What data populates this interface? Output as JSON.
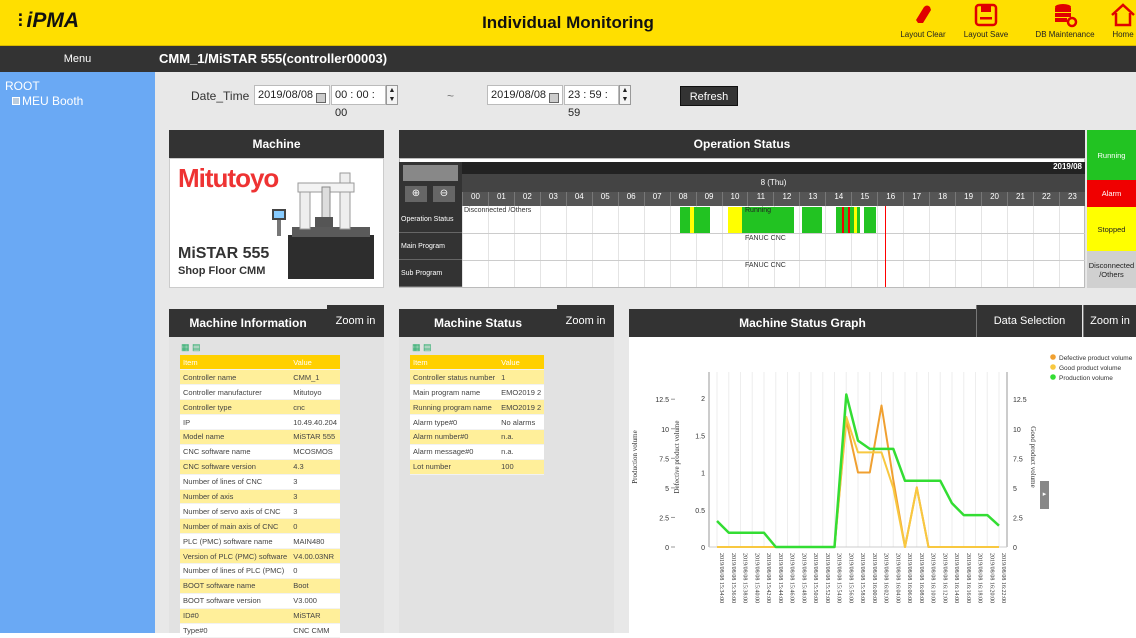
{
  "app": {
    "logo": "iPMA",
    "title": "Individual Monitoring",
    "toolbar": [
      {
        "label": "Layout Clear",
        "icon": "eraser-icon",
        "color": "#e00000"
      },
      {
        "label": "Layout Save",
        "icon": "save-icon",
        "color": "#e00000"
      },
      {
        "label": "DB Maintenance",
        "icon": "database-gear-icon",
        "color": "#e00000"
      },
      {
        "label": "Home",
        "icon": "home-icon",
        "color": "#e00000"
      }
    ]
  },
  "menu": {
    "label": "Menu"
  },
  "breadcrumb": "CMM_1/MiSTAR 555(controller00003)",
  "tree": {
    "root": "ROOT",
    "child": "MEU Booth"
  },
  "datetime": {
    "label": "Date_Time",
    "from_date": "2019/08/08",
    "from_time": "00 : 00 : 00",
    "separator": "~",
    "to_date": "2019/08/08",
    "to_time": "23 : 59 : 59",
    "refresh": "Refresh"
  },
  "machine_panel": {
    "title": "Machine",
    "brand": "Mitutoyo",
    "model": "MiSTAR 555",
    "subtitle": "Shop Floor CMM"
  },
  "operation": {
    "title": "Operation Status",
    "year": "2019/08",
    "day": "8 (Thu)",
    "hours": [
      "00",
      "01",
      "02",
      "03",
      "04",
      "05",
      "06",
      "07",
      "08",
      "09",
      "10",
      "11",
      "12",
      "13",
      "14",
      "15",
      "16",
      "17",
      "18",
      "19",
      "20",
      "21",
      "22",
      "23"
    ],
    "rows": [
      "Operation Status",
      "Main Program",
      "Sub Program"
    ],
    "row_texts": {
      "disconnected": "Disconnected /Others",
      "running": "Running",
      "main_program": "FANUC CNC",
      "sub_program": "FANUC CNC"
    },
    "legend": [
      {
        "label": "Running",
        "color": "#22c322"
      },
      {
        "label": "Alarm",
        "color": "#f00000"
      },
      {
        "label": "Stopped",
        "color": "#ffff00"
      },
      {
        "label": "Disconnected /Others",
        "color": "#d0d0d0"
      }
    ]
  },
  "machine_info": {
    "title": "Machine Information",
    "zoom": "Zoom in",
    "header": [
      "Item",
      "Value"
    ],
    "rows": [
      [
        "Controller name",
        "CMM_1"
      ],
      [
        "Controller manufacturer",
        "Mitutoyo"
      ],
      [
        "Controller type",
        "cnc"
      ],
      [
        "IP",
        "10.49.40.204"
      ],
      [
        "Model name",
        "MiSTAR 555"
      ],
      [
        "CNC software name",
        "MCOSMOS"
      ],
      [
        "CNC software version",
        "4.3"
      ],
      [
        "Number of lines of CNC",
        "3"
      ],
      [
        "Number of axis",
        "3"
      ],
      [
        "Number of servo axis of CNC",
        "3"
      ],
      [
        "Number of main axis of CNC",
        "0"
      ],
      [
        "PLC (PMC) software name",
        "MAIN480"
      ],
      [
        "Version of PLC (PMC) software",
        "V4.00.03NR"
      ],
      [
        "Number of lines of PLC (PMC)",
        "0"
      ],
      [
        "BOOT software name",
        "Boot"
      ],
      [
        "BOOT software version",
        "V3.000"
      ],
      [
        "ID#0",
        "MiSTAR"
      ],
      [
        "Type#0",
        "CNC CMM"
      ]
    ]
  },
  "machine_status": {
    "title": "Machine Status",
    "zoom": "Zoom in",
    "header": [
      "Item",
      "Value"
    ],
    "rows": [
      [
        "Controller status number",
        "1"
      ],
      [
        "Main program name",
        "EMO2019 2"
      ],
      [
        "Running program name",
        "EMO2019 2"
      ],
      [
        "Alarm type#0",
        "No alarms"
      ],
      [
        "Alarm number#0",
        "n.a."
      ],
      [
        "Alarm message#0",
        "n.a."
      ],
      [
        "Lot number",
        "100"
      ]
    ]
  },
  "graph": {
    "title": "Machine Status Graph",
    "data_selection": "Data Selection",
    "zoom": "Zoom in",
    "chart_data": {
      "type": "line",
      "ylabel_left_outer": "Production volume",
      "ylabel_left_inner": "Defective product volume",
      "ylabel_right": "Good product volume",
      "left_outer_ticks": [
        "12.5",
        "10",
        "7.5",
        "5",
        "2.5",
        "0"
      ],
      "left_inner_ticks": [
        "2",
        "1.5",
        "1",
        "0.5",
        "0"
      ],
      "right_ticks": [
        "12.5",
        "10",
        "7.5",
        "5",
        "2.5",
        "0"
      ],
      "legend": [
        "Defective product volume",
        "Good product volume",
        "Production volume"
      ],
      "x": [
        "2019/08/08 15:34:00",
        "2019/08/08 15:36:00",
        "2019/08/08 15:38:00",
        "2019/08/08 15:40:00",
        "2019/08/08 15:42:00",
        "2019/08/08 15:44:00",
        "2019/08/08 15:46:00",
        "2019/08/08 15:48:00",
        "2019/08/08 15:50:00",
        "2019/08/08 15:52:00",
        "2019/08/08 15:54:00",
        "2019/08/08 15:56:00",
        "2019/08/08 15:58:00",
        "2019/08/08 16:00:00",
        "2019/08/08 16:02:00",
        "2019/08/08 16:04:00",
        "2019/08/08 16:06:00",
        "2019/08/08 16:08:00",
        "2019/08/08 16:10:00",
        "2019/08/08 16:12:00",
        "2019/08/08 16:14:00",
        "2019/08/08 16:16:00",
        "2019/08/08 16:18:00",
        "2019/08/08 16:20:00",
        "2019/08/08 16:22:00"
      ],
      "series": [
        {
          "name": "Defective product volume",
          "color": "#f0a030",
          "axis": "inner",
          "values": [
            0,
            0,
            0,
            0,
            0,
            0,
            0,
            0,
            0,
            0,
            0,
            1.7,
            1.0,
            1.0,
            1.9,
            0.9,
            0,
            0.8,
            0,
            0,
            0,
            0,
            0,
            0,
            0
          ]
        },
        {
          "name": "Good product volume",
          "color": "#f8c840",
          "axis": "outer",
          "values": [
            0,
            0,
            0,
            0,
            0,
            0,
            0,
            0,
            0,
            0,
            0,
            11,
            8,
            8,
            8,
            5,
            0,
            5,
            0,
            0,
            0,
            0,
            0,
            0,
            0
          ]
        },
        {
          "name": "Production volume",
          "color": "#33dd33",
          "axis": "outer",
          "values": [
            2.2,
            1.2,
            1.2,
            1.2,
            1.2,
            0,
            0,
            0,
            0,
            0,
            0,
            12.9,
            9,
            8.3,
            8.3,
            8.3,
            5.6,
            5.6,
            5.6,
            5.6,
            3.7,
            2.7,
            2.7,
            2.7,
            1.8
          ]
        }
      ]
    }
  }
}
